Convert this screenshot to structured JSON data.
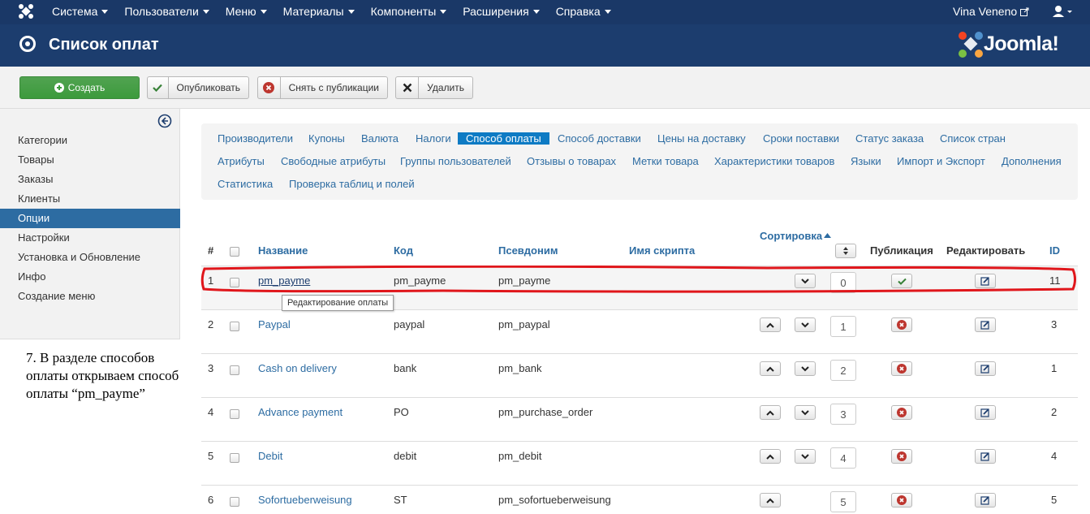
{
  "topbar": {
    "menu": [
      "Система",
      "Пользователи",
      "Меню",
      "Материалы",
      "Компоненты",
      "Расширения",
      "Справка"
    ],
    "user": "Vina Veneno"
  },
  "header": {
    "title": "Список оплат",
    "brand": "Joomla!"
  },
  "toolbar": {
    "create": "Создать",
    "publish": "Опубликовать",
    "unpublish": "Снять с публикации",
    "delete": "Удалить"
  },
  "sidebar": {
    "items": [
      "Категории",
      "Товары",
      "Заказы",
      "Клиенты",
      "Опции",
      "Настройки",
      "Установка и Обновление",
      "Инфо",
      "Создание меню"
    ],
    "active": "Опции"
  },
  "note": "7. В разделе способов оплаты открываем способ оплаты “pm_payme”",
  "subnav": {
    "row1": [
      "Производители",
      "Купоны",
      "Валюта",
      "Налоги",
      "Способ оплаты",
      "Способ доставки",
      "Цены на доставку",
      "Сроки поставки",
      "Статус заказа",
      "Список стран"
    ],
    "row2": [
      "Атрибуты",
      "Свободные атрибуты",
      "Группы пользователей",
      "Отзывы о товарах",
      "Метки товара",
      "Характеристики товаров",
      "Языки",
      "Импорт и Экспорт",
      "Дополнения"
    ],
    "row3": [
      "Статистика",
      "Проверка таблиц и полей"
    ],
    "active": "Способ оплаты"
  },
  "table": {
    "headers": {
      "num": "#",
      "name": "Название",
      "code": "Код",
      "alias": "Псевдоним",
      "script": "Имя скрипта",
      "sort": "Сортировка",
      "publish": "Публикация",
      "edit": "Редактировать",
      "id": "ID"
    },
    "rows": [
      {
        "num": "1",
        "name": "pm_payme",
        "code": "pm_payme",
        "alias": "pm_payme",
        "order": "0",
        "id": "11"
      },
      {
        "num": "2",
        "name": "Paypal",
        "code": "paypal",
        "alias": "pm_paypal",
        "order": "1",
        "id": "3"
      },
      {
        "num": "3",
        "name": "Cash on delivery",
        "code": "bank",
        "alias": "pm_bank",
        "order": "2",
        "id": "1"
      },
      {
        "num": "4",
        "name": "Advance payment",
        "code": "PO",
        "alias": "pm_purchase_order",
        "order": "3",
        "id": "2"
      },
      {
        "num": "5",
        "name": "Debit",
        "code": "debit",
        "alias": "pm_debit",
        "order": "4",
        "id": "4"
      },
      {
        "num": "6",
        "name": "Sofortueberweisung",
        "code": "ST",
        "alias": "pm_sofortueberweisung",
        "order": "5",
        "id": "5"
      }
    ],
    "tooltip": "Редактирование оплаты"
  },
  "colors": {
    "topbar": "#1a3867",
    "header": "#1c3d6e",
    "link": "#2d6ca2",
    "active_tab": "#0e7bc4",
    "highlight": "#e0161b"
  }
}
